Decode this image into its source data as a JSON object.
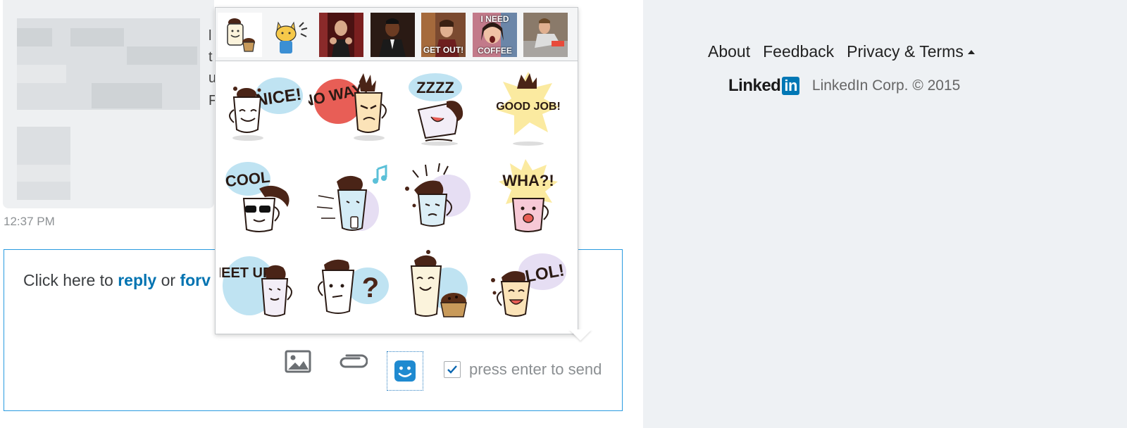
{
  "message": {
    "timestamp": "12:37 PM",
    "peek_letters": [
      "l",
      "t",
      "u",
      "F"
    ]
  },
  "composer": {
    "prompt_before": "Click here to ",
    "reply_link": "reply",
    "prompt_mid": " or ",
    "forward_link": "forv",
    "send_on_enter_label": "press enter to send",
    "send_on_enter_checked": true
  },
  "sticker_popover": {
    "pack_tabs": [
      {
        "name": "coffee-cup-pack",
        "label": "",
        "selected": true
      },
      {
        "name": "cat-pack",
        "label": "",
        "selected": false
      },
      {
        "name": "gif-clapping-man",
        "label": "",
        "selected": false
      },
      {
        "name": "gif-applause-man",
        "label": "",
        "selected": false
      },
      {
        "name": "gif-get-out",
        "label": "GET OUT!",
        "selected": false
      },
      {
        "name": "gif-need-coffee",
        "label_top": "I NEED",
        "label": "COFFEE",
        "selected": false
      },
      {
        "name": "gif-office-man",
        "label": "",
        "selected": false
      }
    ],
    "stickers": [
      {
        "name": "nice",
        "text": "NICE!"
      },
      {
        "name": "no-way",
        "text": "NO WAY!"
      },
      {
        "name": "zzzz",
        "text": "ZZZZ"
      },
      {
        "name": "good-job",
        "text": "GOOD JOB!"
      },
      {
        "name": "cool",
        "text": "COOL"
      },
      {
        "name": "music",
        "text": ""
      },
      {
        "name": "surprised",
        "text": ""
      },
      {
        "name": "wha",
        "text": "WHA?!"
      },
      {
        "name": "meet-up",
        "text": "MEET UP?"
      },
      {
        "name": "question",
        "text": "?"
      },
      {
        "name": "muffin",
        "text": ""
      },
      {
        "name": "lol",
        "text": "LOL!"
      }
    ]
  },
  "footer": {
    "links": [
      "About",
      "Feedback",
      "Privacy & Terms"
    ],
    "logo_text": "Linked",
    "logo_in": "in",
    "copyright": "LinkedIn Corp. © 2015"
  },
  "colors": {
    "accent": "#0073b1",
    "composer_border": "#2a9be0",
    "footer_bg": "#eef1f4"
  }
}
